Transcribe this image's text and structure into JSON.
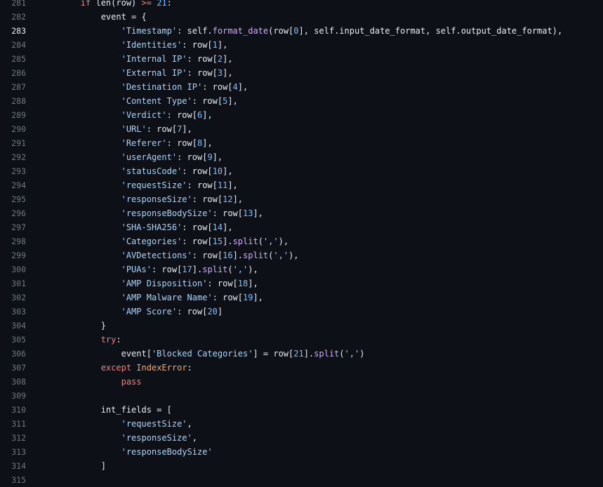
{
  "editor": {
    "current_line": 283,
    "colors": {
      "background": "#0d1117",
      "line_number": "#6e7681",
      "text": "#e6edf3",
      "string": "#a5d6ff",
      "keyword": "#ff7b72",
      "number": "#79c0ff",
      "function": "#d2a8ff",
      "class": "#ffa657"
    },
    "lines": [
      {
        "n": "281",
        "indent": "        ",
        "tokens": [
          {
            "t": "if",
            "c": "kw"
          },
          {
            "t": " len(row) ",
            "c": "txt"
          },
          {
            "t": ">=",
            "c": "op"
          },
          {
            "t": " ",
            "c": "txt"
          },
          {
            "t": "21",
            "c": "num"
          },
          {
            "t": ":",
            "c": "txt"
          }
        ]
      },
      {
        "n": "282",
        "indent": "            ",
        "tokens": [
          {
            "t": "event = {",
            "c": "txt"
          }
        ]
      },
      {
        "n": "283",
        "indent": "                ",
        "tokens": [
          {
            "t": "'Timestamp'",
            "c": "str"
          },
          {
            "t": ": self.",
            "c": "txt"
          },
          {
            "t": "format_date",
            "c": "fn"
          },
          {
            "t": "(row[",
            "c": "txt"
          },
          {
            "t": "0",
            "c": "num"
          },
          {
            "t": "], self.input_date_format, self.output_date_format),",
            "c": "txt"
          }
        ]
      },
      {
        "n": "284",
        "indent": "                ",
        "tokens": [
          {
            "t": "'Identities'",
            "c": "str"
          },
          {
            "t": ": row[",
            "c": "txt"
          },
          {
            "t": "1",
            "c": "num"
          },
          {
            "t": "],",
            "c": "txt"
          }
        ]
      },
      {
        "n": "285",
        "indent": "                ",
        "tokens": [
          {
            "t": "'Internal IP'",
            "c": "str"
          },
          {
            "t": ": row[",
            "c": "txt"
          },
          {
            "t": "2",
            "c": "num"
          },
          {
            "t": "],",
            "c": "txt"
          }
        ]
      },
      {
        "n": "286",
        "indent": "                ",
        "tokens": [
          {
            "t": "'External IP'",
            "c": "str"
          },
          {
            "t": ": row[",
            "c": "txt"
          },
          {
            "t": "3",
            "c": "num"
          },
          {
            "t": "],",
            "c": "txt"
          }
        ]
      },
      {
        "n": "287",
        "indent": "                ",
        "tokens": [
          {
            "t": "'Destination IP'",
            "c": "str"
          },
          {
            "t": ": row[",
            "c": "txt"
          },
          {
            "t": "4",
            "c": "num"
          },
          {
            "t": "],",
            "c": "txt"
          }
        ]
      },
      {
        "n": "288",
        "indent": "                ",
        "tokens": [
          {
            "t": "'Content Type'",
            "c": "str"
          },
          {
            "t": ": row[",
            "c": "txt"
          },
          {
            "t": "5",
            "c": "num"
          },
          {
            "t": "],",
            "c": "txt"
          }
        ]
      },
      {
        "n": "289",
        "indent": "                ",
        "tokens": [
          {
            "t": "'Verdict'",
            "c": "str"
          },
          {
            "t": ": row[",
            "c": "txt"
          },
          {
            "t": "6",
            "c": "num"
          },
          {
            "t": "],",
            "c": "txt"
          }
        ]
      },
      {
        "n": "290",
        "indent": "                ",
        "tokens": [
          {
            "t": "'URL'",
            "c": "str"
          },
          {
            "t": ": row[",
            "c": "txt"
          },
          {
            "t": "7",
            "c": "num"
          },
          {
            "t": "],",
            "c": "txt"
          }
        ]
      },
      {
        "n": "291",
        "indent": "                ",
        "tokens": [
          {
            "t": "'Referer'",
            "c": "str"
          },
          {
            "t": ": row[",
            "c": "txt"
          },
          {
            "t": "8",
            "c": "num"
          },
          {
            "t": "],",
            "c": "txt"
          }
        ]
      },
      {
        "n": "292",
        "indent": "                ",
        "tokens": [
          {
            "t": "'userAgent'",
            "c": "str"
          },
          {
            "t": ": row[",
            "c": "txt"
          },
          {
            "t": "9",
            "c": "num"
          },
          {
            "t": "],",
            "c": "txt"
          }
        ]
      },
      {
        "n": "293",
        "indent": "                ",
        "tokens": [
          {
            "t": "'statusCode'",
            "c": "str"
          },
          {
            "t": ": row[",
            "c": "txt"
          },
          {
            "t": "10",
            "c": "num"
          },
          {
            "t": "],",
            "c": "txt"
          }
        ]
      },
      {
        "n": "294",
        "indent": "                ",
        "tokens": [
          {
            "t": "'requestSize'",
            "c": "str"
          },
          {
            "t": ": row[",
            "c": "txt"
          },
          {
            "t": "11",
            "c": "num"
          },
          {
            "t": "],",
            "c": "txt"
          }
        ]
      },
      {
        "n": "295",
        "indent": "                ",
        "tokens": [
          {
            "t": "'responseSize'",
            "c": "str"
          },
          {
            "t": ": row[",
            "c": "txt"
          },
          {
            "t": "12",
            "c": "num"
          },
          {
            "t": "],",
            "c": "txt"
          }
        ]
      },
      {
        "n": "296",
        "indent": "                ",
        "tokens": [
          {
            "t": "'responseBodySize'",
            "c": "str"
          },
          {
            "t": ": row[",
            "c": "txt"
          },
          {
            "t": "13",
            "c": "num"
          },
          {
            "t": "],",
            "c": "txt"
          }
        ]
      },
      {
        "n": "297",
        "indent": "                ",
        "tokens": [
          {
            "t": "'SHA-SHA256'",
            "c": "str"
          },
          {
            "t": ": row[",
            "c": "txt"
          },
          {
            "t": "14",
            "c": "num"
          },
          {
            "t": "],",
            "c": "txt"
          }
        ]
      },
      {
        "n": "298",
        "indent": "                ",
        "tokens": [
          {
            "t": "'Categories'",
            "c": "str"
          },
          {
            "t": ": row[",
            "c": "txt"
          },
          {
            "t": "15",
            "c": "num"
          },
          {
            "t": "].",
            "c": "txt"
          },
          {
            "t": "split",
            "c": "fn"
          },
          {
            "t": "(",
            "c": "txt"
          },
          {
            "t": "','",
            "c": "str"
          },
          {
            "t": "),",
            "c": "txt"
          }
        ]
      },
      {
        "n": "299",
        "indent": "                ",
        "tokens": [
          {
            "t": "'AVDetections'",
            "c": "str"
          },
          {
            "t": ": row[",
            "c": "txt"
          },
          {
            "t": "16",
            "c": "num"
          },
          {
            "t": "].",
            "c": "txt"
          },
          {
            "t": "split",
            "c": "fn"
          },
          {
            "t": "(",
            "c": "txt"
          },
          {
            "t": "','",
            "c": "str"
          },
          {
            "t": "),",
            "c": "txt"
          }
        ]
      },
      {
        "n": "300",
        "indent": "                ",
        "tokens": [
          {
            "t": "'PUAs'",
            "c": "str"
          },
          {
            "t": ": row[",
            "c": "txt"
          },
          {
            "t": "17",
            "c": "num"
          },
          {
            "t": "].",
            "c": "txt"
          },
          {
            "t": "split",
            "c": "fn"
          },
          {
            "t": "(",
            "c": "txt"
          },
          {
            "t": "','",
            "c": "str"
          },
          {
            "t": "),",
            "c": "txt"
          }
        ]
      },
      {
        "n": "301",
        "indent": "                ",
        "tokens": [
          {
            "t": "'AMP Disposition'",
            "c": "str"
          },
          {
            "t": ": row[",
            "c": "txt"
          },
          {
            "t": "18",
            "c": "num"
          },
          {
            "t": "],",
            "c": "txt"
          }
        ]
      },
      {
        "n": "302",
        "indent": "                ",
        "tokens": [
          {
            "t": "'AMP Malware Name'",
            "c": "str"
          },
          {
            "t": ": row[",
            "c": "txt"
          },
          {
            "t": "19",
            "c": "num"
          },
          {
            "t": "],",
            "c": "txt"
          }
        ]
      },
      {
        "n": "303",
        "indent": "                ",
        "tokens": [
          {
            "t": "'AMP Score'",
            "c": "str"
          },
          {
            "t": ": row[",
            "c": "txt"
          },
          {
            "t": "20",
            "c": "num"
          },
          {
            "t": "]",
            "c": "txt"
          }
        ]
      },
      {
        "n": "304",
        "indent": "            ",
        "tokens": [
          {
            "t": "}",
            "c": "txt"
          }
        ]
      },
      {
        "n": "305",
        "indent": "            ",
        "tokens": [
          {
            "t": "try",
            "c": "kw"
          },
          {
            "t": ":",
            "c": "txt"
          }
        ]
      },
      {
        "n": "306",
        "indent": "                ",
        "tokens": [
          {
            "t": "event[",
            "c": "txt"
          },
          {
            "t": "'Blocked Categories'",
            "c": "str"
          },
          {
            "t": "] = row[",
            "c": "txt"
          },
          {
            "t": "21",
            "c": "num"
          },
          {
            "t": "].",
            "c": "txt"
          },
          {
            "t": "split",
            "c": "fn"
          },
          {
            "t": "(",
            "c": "txt"
          },
          {
            "t": "','",
            "c": "str"
          },
          {
            "t": ")",
            "c": "txt"
          }
        ]
      },
      {
        "n": "307",
        "indent": "            ",
        "tokens": [
          {
            "t": "except",
            "c": "kw"
          },
          {
            "t": " ",
            "c": "txt"
          },
          {
            "t": "IndexError",
            "c": "cls"
          },
          {
            "t": ":",
            "c": "txt"
          }
        ]
      },
      {
        "n": "308",
        "indent": "                ",
        "tokens": [
          {
            "t": "pass",
            "c": "kw"
          }
        ]
      },
      {
        "n": "309",
        "indent": "",
        "tokens": []
      },
      {
        "n": "310",
        "indent": "            ",
        "tokens": [
          {
            "t": "int_fields = [",
            "c": "txt"
          }
        ]
      },
      {
        "n": "311",
        "indent": "                ",
        "tokens": [
          {
            "t": "'requestSize'",
            "c": "str"
          },
          {
            "t": ",",
            "c": "txt"
          }
        ]
      },
      {
        "n": "312",
        "indent": "                ",
        "tokens": [
          {
            "t": "'responseSize'",
            "c": "str"
          },
          {
            "t": ",",
            "c": "txt"
          }
        ]
      },
      {
        "n": "313",
        "indent": "                ",
        "tokens": [
          {
            "t": "'responseBodySize'",
            "c": "str"
          }
        ]
      },
      {
        "n": "314",
        "indent": "            ",
        "tokens": [
          {
            "t": "]",
            "c": "txt"
          }
        ]
      },
      {
        "n": "315",
        "indent": "",
        "tokens": []
      }
    ]
  }
}
